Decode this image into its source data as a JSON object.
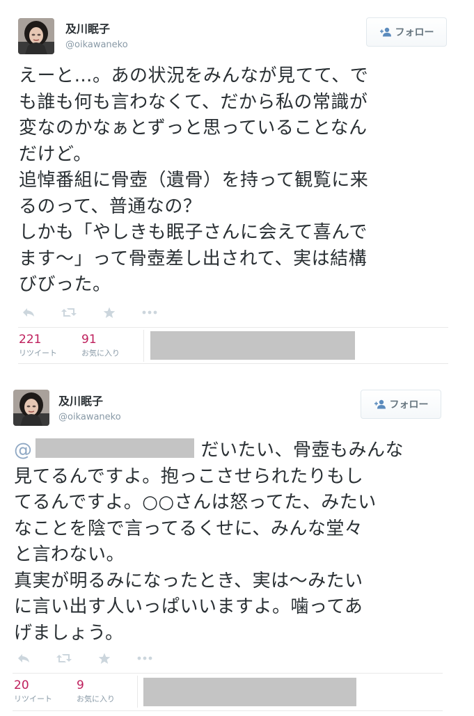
{
  "tweets": [
    {
      "user": {
        "name": "及川眠子",
        "handle": "@oikawaneko"
      },
      "follow_label": "フォロー",
      "text_lines": [
        "えーと…。あの状況をみんなが見てて、で",
        "も誰も何も言わなくて、だから私の常識が",
        "変なのかなぁとずっと思っていることなん",
        "だけど。",
        "追悼番組に骨壺（遺骨）を持って観覧に来",
        "るのって、普通なの？",
        "しかも「やしきも眠子さんに会えて喜んで",
        "ます～」って骨壺差し出されて、実は結構",
        "びびった。"
      ],
      "stats": {
        "retweets": {
          "count": "221",
          "label": "リツイート"
        },
        "favorites": {
          "count": "91",
          "label": "お気に入り"
        }
      }
    },
    {
      "user": {
        "name": "及川眠子",
        "handle": "@oikawaneko"
      },
      "follow_label": "フォロー",
      "mention_at": "@",
      "first_line_rest": "だいたい、骨壺もみんな",
      "text_lines": [
        "見てるんですよ。抱っこさせられたりもし",
        "てるんですよ。○○さんは怒ってた、みたい",
        "なことを陰で言ってるくせに、みんな堂々",
        "と言わない。",
        "真実が明るみになったとき、実は～みたい",
        "に言い出す人いっぱいいますよ。噛ってあ",
        "げましょう。"
      ],
      "stats": {
        "retweets": {
          "count": "20",
          "label": "リツイート"
        },
        "favorites": {
          "count": "9",
          "label": "お気に入り"
        }
      }
    }
  ],
  "icons": {
    "reply": "reply-icon",
    "retweet": "retweet-icon",
    "favorite": "star-icon",
    "more": "more-icon",
    "follow": "follow-person-icon"
  },
  "colors": {
    "stat_count": "#be1e5b",
    "muted": "#8899a6",
    "text": "#292f33",
    "redaction": "#c4c4c4"
  }
}
